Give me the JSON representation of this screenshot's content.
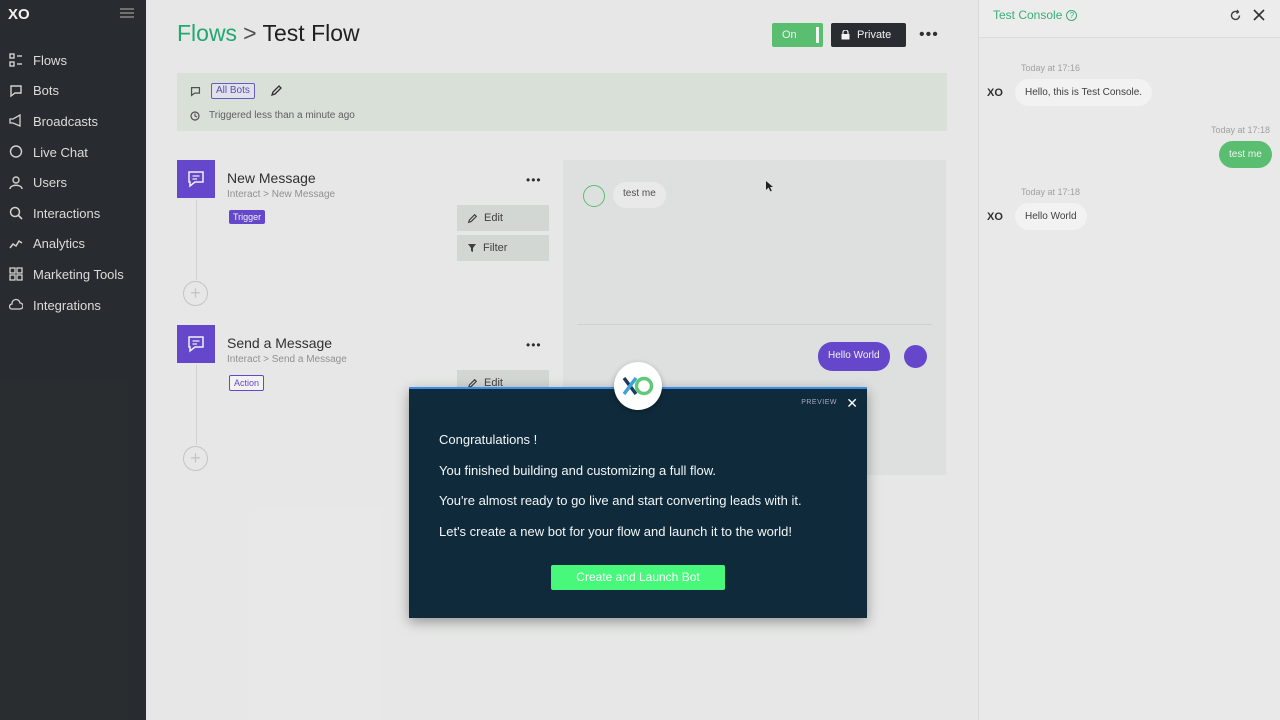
{
  "sidebar": {
    "logo": "XO",
    "items": [
      {
        "label": "Flows",
        "icon": "flows-icon"
      },
      {
        "label": "Bots",
        "icon": "bots-icon"
      },
      {
        "label": "Broadcasts",
        "icon": "megaphone-icon"
      },
      {
        "label": "Live Chat",
        "icon": "chat-bubble-icon"
      },
      {
        "label": "Users",
        "icon": "users-icon"
      },
      {
        "label": "Interactions",
        "icon": "search-icon"
      },
      {
        "label": "Analytics",
        "icon": "analytics-icon"
      },
      {
        "label": "Marketing Tools",
        "icon": "grid-icon"
      },
      {
        "label": "Integrations",
        "icon": "cloud-icon"
      }
    ]
  },
  "header": {
    "breadcrumb_root": "Flows",
    "breadcrumb_sep": ">",
    "breadcrumb_current": "Test Flow",
    "toggle_label": "On",
    "private_label": "Private",
    "more_label": "•••"
  },
  "trigger_bar": {
    "bots_label": "All Bots",
    "status": "Triggered less than a minute ago"
  },
  "nodes": [
    {
      "title": "New Message",
      "subtitle": "Interact > New Message",
      "badge": "Trigger",
      "edit": "Edit",
      "filter": "Filter",
      "more": "•••"
    },
    {
      "title": "Send a Message",
      "subtitle": "Interact > Send a Message",
      "badge": "Action",
      "edit": "Edit",
      "more": "•••"
    }
  ],
  "preview": {
    "user_msg": "test me",
    "bot_msg": "Hello World"
  },
  "console": {
    "title": "Test Console",
    "messages": [
      {
        "time": "Today at 17:16",
        "text": "Hello, this is Test Console."
      },
      {
        "time": "Today at 17:18",
        "text": "test me"
      },
      {
        "time": "Today at 17:18",
        "text": "Hello World"
      }
    ]
  },
  "modal": {
    "preview_label": "PREVIEW",
    "close": "✕",
    "line1": "Congratulations !",
    "line2": "You finished building and customizing a full flow.",
    "line3": "You're almost ready to go live and start converting leads with it.",
    "line4": "Let's create a new bot for your flow and launch it to the world!",
    "cta": "Create and Launch Bot"
  },
  "colors": {
    "accent_green": "#22b27c",
    "accent_purple": "#6b4bd6",
    "modal_bg": "#0f2b3b",
    "cta_green": "#47f87a"
  }
}
